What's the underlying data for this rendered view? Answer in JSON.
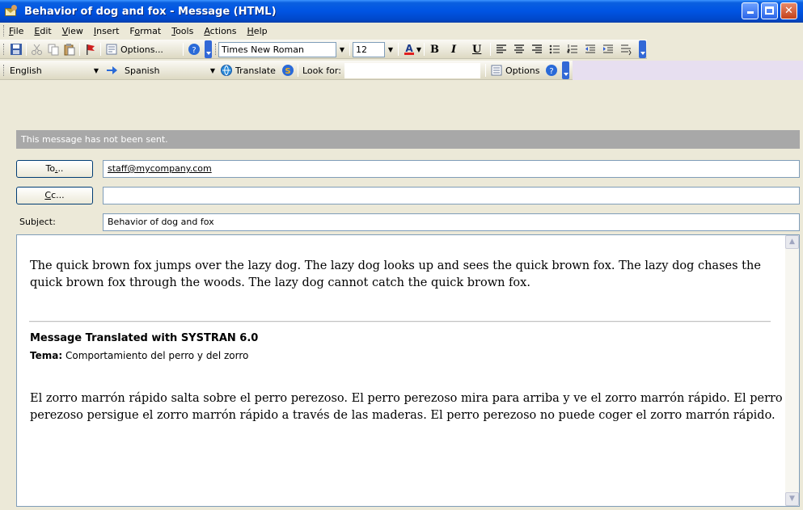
{
  "window": {
    "title": "Behavior of dog and fox - Message (HTML)"
  },
  "menu": {
    "items": [
      "File",
      "Edit",
      "View",
      "Insert",
      "Format",
      "Tools",
      "Actions",
      "Help"
    ],
    "mnemonics": [
      "F",
      "E",
      "V",
      "I",
      "o",
      "T",
      "A",
      "H"
    ]
  },
  "toolbar": {
    "options_label": "Options...",
    "font_name": "Times New Roman",
    "font_size": "12",
    "bold_label": "B",
    "italic_label": "I",
    "underline_label": "U"
  },
  "translate_bar": {
    "from_language": "English",
    "to_language": "Spanish",
    "translate_label": "Translate",
    "look_for_label": "Look for:",
    "look_for_value": "",
    "options_label": "Options"
  },
  "notice": "This message has not been sent.",
  "address": {
    "to_button": "To...",
    "to_value": "staff@mycompany.com",
    "cc_button": "Cc...",
    "cc_value": "",
    "subject_label": "Subject:",
    "subject_value": "Behavior of dog and fox"
  },
  "body": {
    "original": "The quick brown fox jumps over the lazy dog. The lazy dog looks up and sees the quick brown fox. The lazy dog chases the quick brown fox through the woods. The lazy dog cannot catch the quick brown fox.",
    "translation_header": "Message Translated with SYSTRAN 6.0",
    "tema_label": "Tema:",
    "tema_value": "Comportamiento del perro y del zorro",
    "translated": "El zorro marrón rápido salta sobre el perro perezoso. El perro perezoso mira para arriba y ve el zorro marrón rápido. El perro perezoso persigue el zorro marrón rápido a través de las maderas. El perro perezoso no puede coger el zorro marrón rápido."
  },
  "colors": {
    "titlebar": "#0054e3",
    "notice_bg": "#a8a8a8",
    "highlight": "#e7dff0"
  }
}
